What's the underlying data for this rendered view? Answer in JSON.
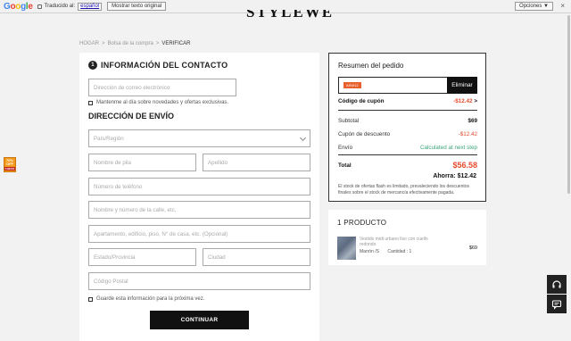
{
  "translate_bar": {
    "logo": "Google",
    "translated_to": "Traducido al:",
    "language": "español",
    "show_original": "Mostrar texto original",
    "options": "Opciones ▼",
    "close": "×"
  },
  "site": {
    "logo": "STYLEWE"
  },
  "breadcrumb": {
    "home": "HOGAR",
    "cart": "Bolsa de la compra",
    "current": "VERIFICAR",
    "separator": ">"
  },
  "contact": {
    "step": "1",
    "title": "INFORMACIÓN DEL CONTACTO",
    "email_placeholder": "Dirección de correo electrónico",
    "newsletter_label": "Mantenme al día sobre novedades y ofertas exclusivas."
  },
  "shipping": {
    "title": "DIRECCIÓN DE ENVÍO",
    "country_placeholder": "País/Región",
    "first_name_placeholder": "Nombre de pila",
    "last_name_placeholder": "Apellido",
    "phone_placeholder": "Número de teléfono",
    "street_placeholder": "Nombre y número de la calle, etc.",
    "apartment_placeholder": "Apartamento, edificio, piso, N° de casa, etc. (Opcional)",
    "state_placeholder": "Estado/Provincia",
    "city_placeholder": "Ciudad",
    "zip_placeholder": "Código Postal",
    "save_label": "Guarde esta información para la próxima vez.",
    "continue_label": "CONTINUAR"
  },
  "summary": {
    "title": "Resumen del pedido",
    "coupon_tag": "ASW12",
    "apply_label": "Eliminar",
    "coupon_label": "Código de cupón",
    "coupon_value": "-$12.42",
    "coupon_chevron": ">",
    "subtotal_label": "Subtotal",
    "subtotal_value": "$69",
    "discount_label": "Cupón de descuento",
    "discount_value": "-$12.42",
    "shipping_label": "Envío",
    "shipping_value": "Calculated at next step",
    "total_label": "Total",
    "total_value": "$56.58",
    "savings_label": "Ahorra:",
    "savings_value": "$12.42",
    "note": "El stock de ofertas flash es limitado, prevaleciendo los descuentos finales sobre el stock de mercancía efectivamente pagada."
  },
  "product": {
    "title": "1 PRODUCTO",
    "name": "Vestido midi urbano liso con cuello redondo",
    "color": "Marrón /S",
    "quantity": "Cantidad : 1",
    "price": "$69"
  },
  "badge": {
    "line1": "70%",
    "line2": "OFF",
    "line3": "CHECK"
  },
  "floats": {
    "support_icon": "headset-icon",
    "chat_icon": "chat-icon"
  }
}
